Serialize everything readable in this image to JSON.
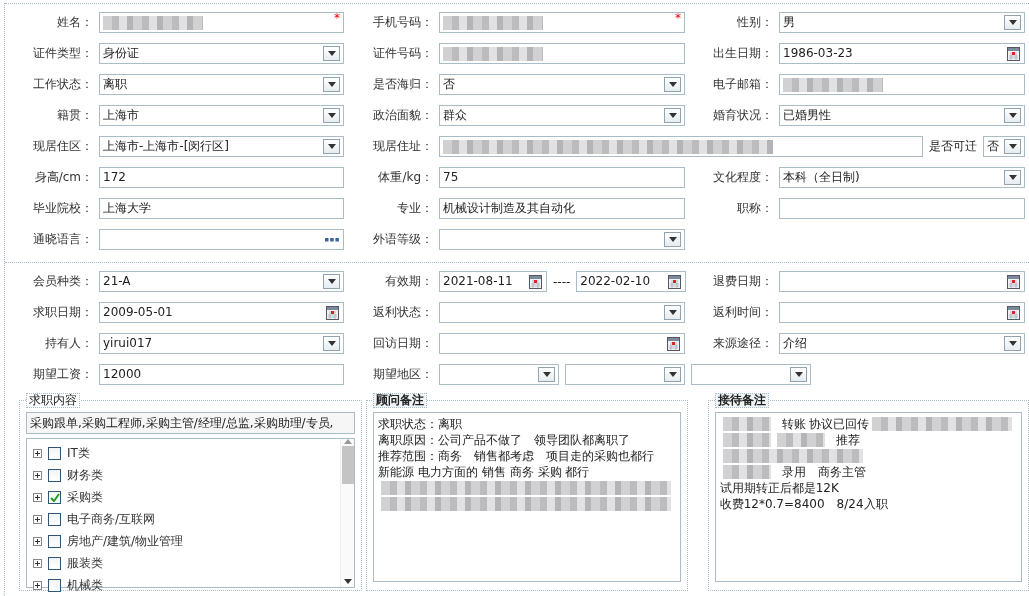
{
  "basic_section": {
    "fields": [
      {
        "label": "姓名：",
        "kind": "text",
        "blurred": true,
        "marker": "*"
      },
      {
        "label": "手机号码：",
        "kind": "text",
        "blurred": true,
        "marker": "*"
      },
      {
        "label": "性别：",
        "kind": "select",
        "value": "男"
      },
      {
        "label": "证件类型：",
        "kind": "select",
        "value": "身份证"
      },
      {
        "label": "证件号码：",
        "kind": "text",
        "blurred": true
      },
      {
        "label": "出生日期：",
        "kind": "date",
        "value": "1986-03-23"
      },
      {
        "label": "工作状态：",
        "kind": "select",
        "value": "离职"
      },
      {
        "label": "是否海归：",
        "kind": "select",
        "value": "否"
      },
      {
        "label": "电子邮箱：",
        "kind": "text",
        "blurred": true
      },
      {
        "label": "籍贯：",
        "kind": "select",
        "value": "上海市"
      },
      {
        "label": "政治面貌：",
        "kind": "select",
        "value": "群众"
      },
      {
        "label": "婚育状况：",
        "kind": "select",
        "value": "已婚男性"
      },
      {
        "label": "现居住区：",
        "kind": "select",
        "value": " 上海市-上海市-[闵行区]"
      },
      {
        "label": "现居住址：",
        "kind": "address",
        "blurred": true,
        "side_label": "是否可迁",
        "side_value": "否"
      },
      {
        "label": "身高/cm：",
        "kind": "text",
        "value": "172"
      },
      {
        "label": "体重/kg：",
        "kind": "text",
        "value": "75"
      },
      {
        "label": "文化程度：",
        "kind": "select",
        "value": "本科（全日制)"
      },
      {
        "label": "毕业院校：",
        "kind": "text",
        "value": "上海大学"
      },
      {
        "label": "专业：",
        "kind": "text",
        "value": "机械设计制造及其自动化"
      },
      {
        "label": "职称：",
        "kind": "text"
      },
      {
        "label": "通晓语言：",
        "kind": "lookup"
      },
      {
        "label": "外语等级：",
        "kind": "select"
      }
    ]
  },
  "membership_section": {
    "fields": [
      {
        "label": "会员种类：",
        "kind": "select",
        "value": " 21-A"
      },
      {
        "label": "有效期：",
        "kind": "date_range",
        "values": [
          "2021-08-11",
          "2022-02-10"
        ],
        "separator": "----"
      },
      {
        "label": "退费日期：",
        "kind": "date"
      },
      {
        "label": "求职日期：",
        "kind": "date",
        "value": "2009-05-01"
      },
      {
        "label": "返利状态：",
        "kind": "select"
      },
      {
        "label": "返利时间：",
        "kind": "date"
      },
      {
        "label": "持有人：",
        "kind": "select",
        "value": "yirui017"
      },
      {
        "label": "回访日期：",
        "kind": "date"
      },
      {
        "label": "来源途径：",
        "kind": "select",
        "value": "介绍"
      },
      {
        "label": "期望工资：",
        "kind": "text",
        "value": "12000"
      },
      {
        "label": "期望地区：",
        "kind": "multi_select",
        "parts": [
          {
            "kind": "select"
          },
          {
            "kind": "select"
          },
          {
            "kind": "select"
          }
        ]
      }
    ]
  },
  "job_panel": {
    "title": "求职内容",
    "summary": "采购跟单,采购工程师,采购主管/经理/总监,采购助理/专员,",
    "tree": [
      {
        "label": "IT类",
        "checked": false,
        "expanded": false
      },
      {
        "label": "财务类",
        "checked": false,
        "expanded": false
      },
      {
        "label": "采购类",
        "checked": true,
        "expanded": false
      },
      {
        "label": "电子商务/互联网",
        "checked": false,
        "expanded": false
      },
      {
        "label": "房地产/建筑/物业管理",
        "checked": false,
        "expanded": false
      },
      {
        "label": "服装类",
        "checked": false,
        "expanded": false
      },
      {
        "label": "机械类",
        "checked": false,
        "expanded": false
      }
    ]
  },
  "notes": [
    {
      "title": "顾问备注",
      "lines": [
        [
          {
            "kind": "text",
            "text": "求职状态：离职"
          }
        ],
        [
          {
            "kind": "text",
            "text": "离职原因：公司产品不做了　领导团队都离职了"
          }
        ],
        [
          {
            "kind": "text",
            "text": "推荐范围：商务　销售都考虑　项目走的采购也都行"
          }
        ],
        [
          {
            "kind": "text",
            "text": "新能源 电力方面的 销售 商务 采购 都行"
          }
        ],
        [
          {
            "kind": "blur"
          }
        ],
        [
          {
            "kind": "blur"
          }
        ]
      ]
    },
    {
      "title": "接待备注",
      "lines": [
        [
          {
            "kind": "blur"
          },
          {
            "kind": "text",
            "text": "转账 协议已回传"
          },
          {
            "kind": "blur"
          }
        ],
        [
          {
            "kind": "blur"
          },
          {
            "kind": "blur"
          },
          {
            "kind": "text",
            "text": "推荐"
          }
        ],
        [
          {
            "kind": "blur"
          }
        ],
        [
          {
            "kind": "blur"
          },
          {
            "kind": "text",
            "text": "录用　商务主管"
          }
        ],
        [
          {
            "kind": "text",
            "text": "试用期转正后都是12K"
          }
        ],
        [
          {
            "kind": "text",
            "text": "收费12*0.7=8400　8/24入职"
          }
        ]
      ]
    }
  ]
}
